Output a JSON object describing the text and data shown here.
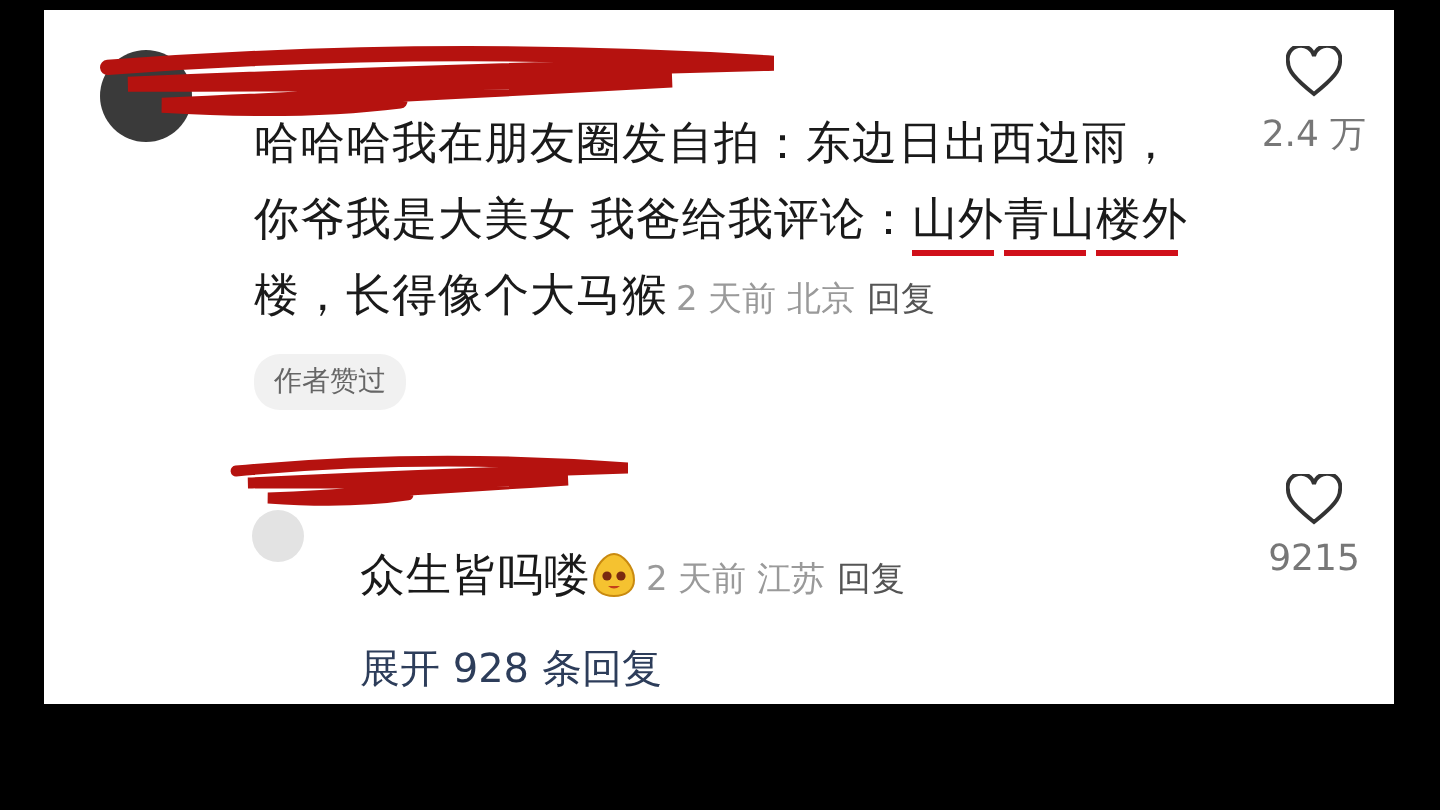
{
  "comments": [
    {
      "segments": [
        {
          "text": "哈哈哈我在朋友圈发自拍：东边日出西边雨，你爷我是大美女 我爸给我评论：",
          "underlined": false
        },
        {
          "text": "山外",
          "underlined": true
        },
        {
          "text": "青山",
          "underlined": true
        },
        {
          "text": "楼外",
          "underlined": true
        },
        {
          "text": "楼，长得像个大马猴",
          "underlined": false
        }
      ],
      "emoji": false,
      "time": "2 天前",
      "location": "北京",
      "reply": "回复",
      "badge": "作者赞过",
      "likes": "2.4 万",
      "is_reply": false
    },
    {
      "segments": [
        {
          "text": "众生皆吗喽",
          "underlined": false
        }
      ],
      "emoji": true,
      "time": "2 天前",
      "location": "江苏",
      "reply": "回复",
      "likes": "9215",
      "is_reply": true,
      "expand": "展开 928 条回复"
    }
  ]
}
